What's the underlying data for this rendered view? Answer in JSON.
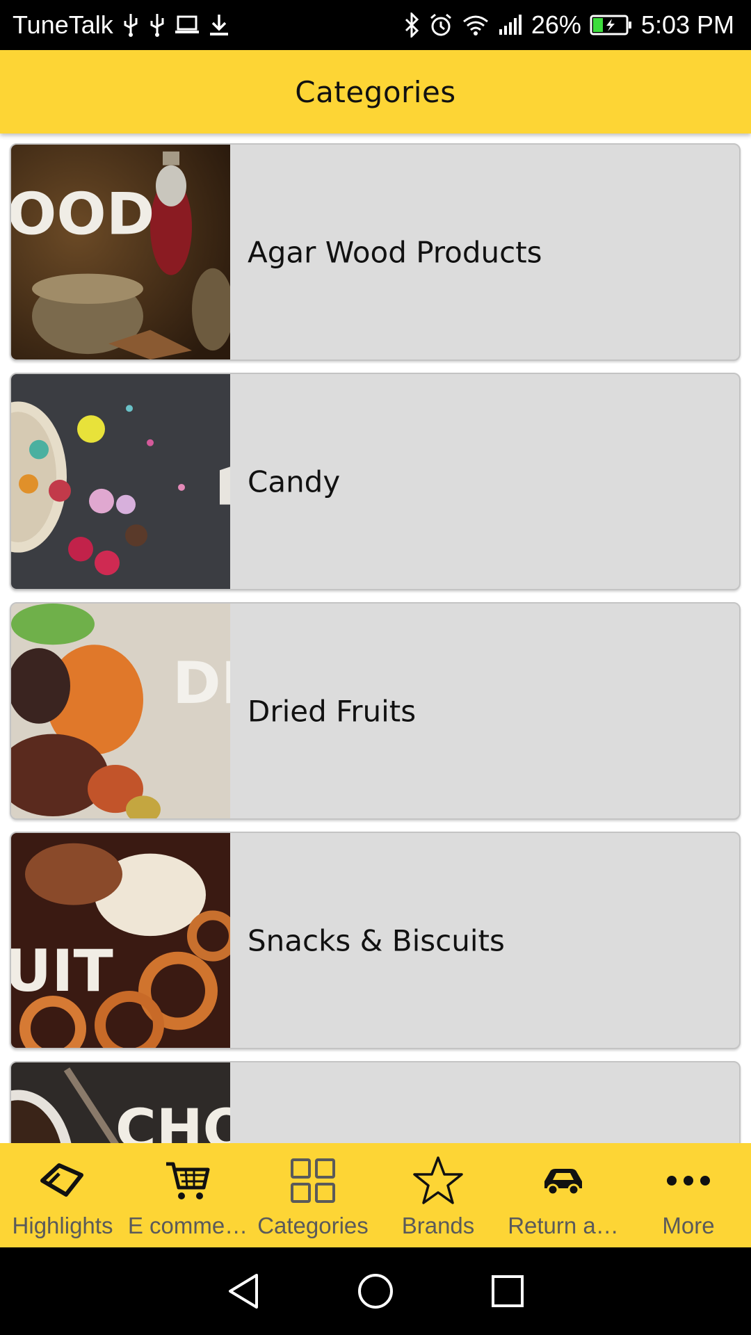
{
  "status_bar": {
    "carrier": "TuneTalk",
    "battery_percent": "26%",
    "time": "5:03 PM",
    "left_icons": [
      "usb-icon",
      "usb-icon",
      "laptop-icon",
      "download-icon"
    ],
    "right_icons": [
      "bluetooth-icon",
      "alarm-icon",
      "wifi-icon",
      "signal-icon",
      "battery-charging-icon"
    ]
  },
  "header": {
    "title": "Categories"
  },
  "categories": [
    {
      "label": "Agar Wood Products",
      "thumb_text": "OOD"
    },
    {
      "label": "Candy",
      "thumb_text": ""
    },
    {
      "label": "Dried Fruits",
      "thumb_text": "DF"
    },
    {
      "label": "Snacks & Biscuits",
      "thumb_text": "UIT"
    },
    {
      "label": "",
      "thumb_text": "CHOC"
    }
  ],
  "bottom_nav": {
    "items": [
      {
        "label": "Highlights",
        "icon": "tag-icon"
      },
      {
        "label": "E comme…",
        "icon": "cart-icon"
      },
      {
        "label": "Categories",
        "icon": "grid-icon"
      },
      {
        "label": "Brands",
        "icon": "star-icon"
      },
      {
        "label": "Return a…",
        "icon": "car-icon"
      },
      {
        "label": "More",
        "icon": "more-dots-icon"
      }
    ]
  },
  "system_nav": [
    "back-icon",
    "home-icon",
    "recents-icon"
  ],
  "colors": {
    "accent": "#fdd535",
    "card_bg": "#dcdcdc",
    "status_bar": "#000000",
    "label_gray": "#5a5a5a"
  }
}
